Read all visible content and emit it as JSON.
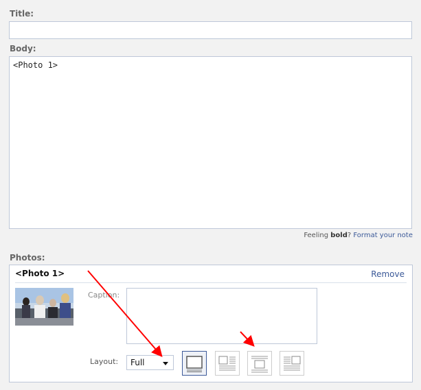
{
  "form": {
    "title_label": "Title:",
    "title_value": "",
    "body_label": "Body:",
    "body_value": "<Photo 1>",
    "feeling_prefix": "Feeling ",
    "feeling_bold": "bold",
    "feeling_suffix": "? ",
    "format_link": "Format your note"
  },
  "photos": {
    "label": "Photos:",
    "item": {
      "title": "<Photo 1>",
      "remove_label": "Remove",
      "caption_label": "Caption:",
      "caption_value": "",
      "layout_label": "Layout:",
      "layout_selected": "Full",
      "layout_options": [
        "full-layout-icon",
        "text-left-layout-icon",
        "centered-layout-icon",
        "text-right-layout-icon"
      ],
      "selected_layout_index": 0
    }
  },
  "colors": {
    "link": "#3b5998",
    "border": "#bdc7d8",
    "arrow": "#ff0000"
  }
}
